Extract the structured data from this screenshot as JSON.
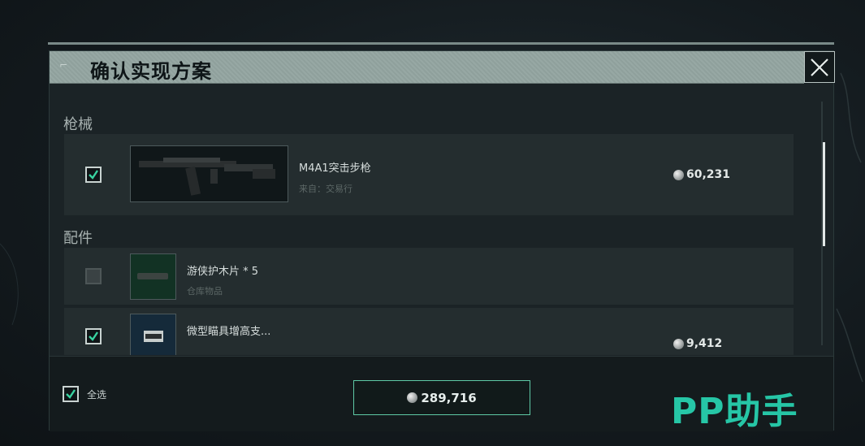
{
  "dialog": {
    "title": "确认实现方案"
  },
  "sections": [
    {
      "title": "枪械",
      "items": [
        {
          "name": "M4A1突击步枪",
          "source": "来自：交易行",
          "price": "60,231",
          "checked": true,
          "thumb_icon": "rifle-image"
        }
      ]
    },
    {
      "title": "配件",
      "items": [
        {
          "name": "游侠护木片 * 5",
          "source": "仓库物品",
          "price": "",
          "checked": false,
          "thumb_icon": "handguard-image"
        },
        {
          "name": "微型瞄具增高支...",
          "source": "",
          "price": "9,412",
          "checked": true,
          "thumb_icon": "mount-image"
        }
      ]
    }
  ],
  "footer": {
    "select_all_label": "全选",
    "select_all_checked": true,
    "total": "289,716"
  },
  "watermark": "PP助手",
  "colors": {
    "accent": "#5ec9a6",
    "watermark": "#26c6a6",
    "title_bar": "#8fa09c"
  }
}
